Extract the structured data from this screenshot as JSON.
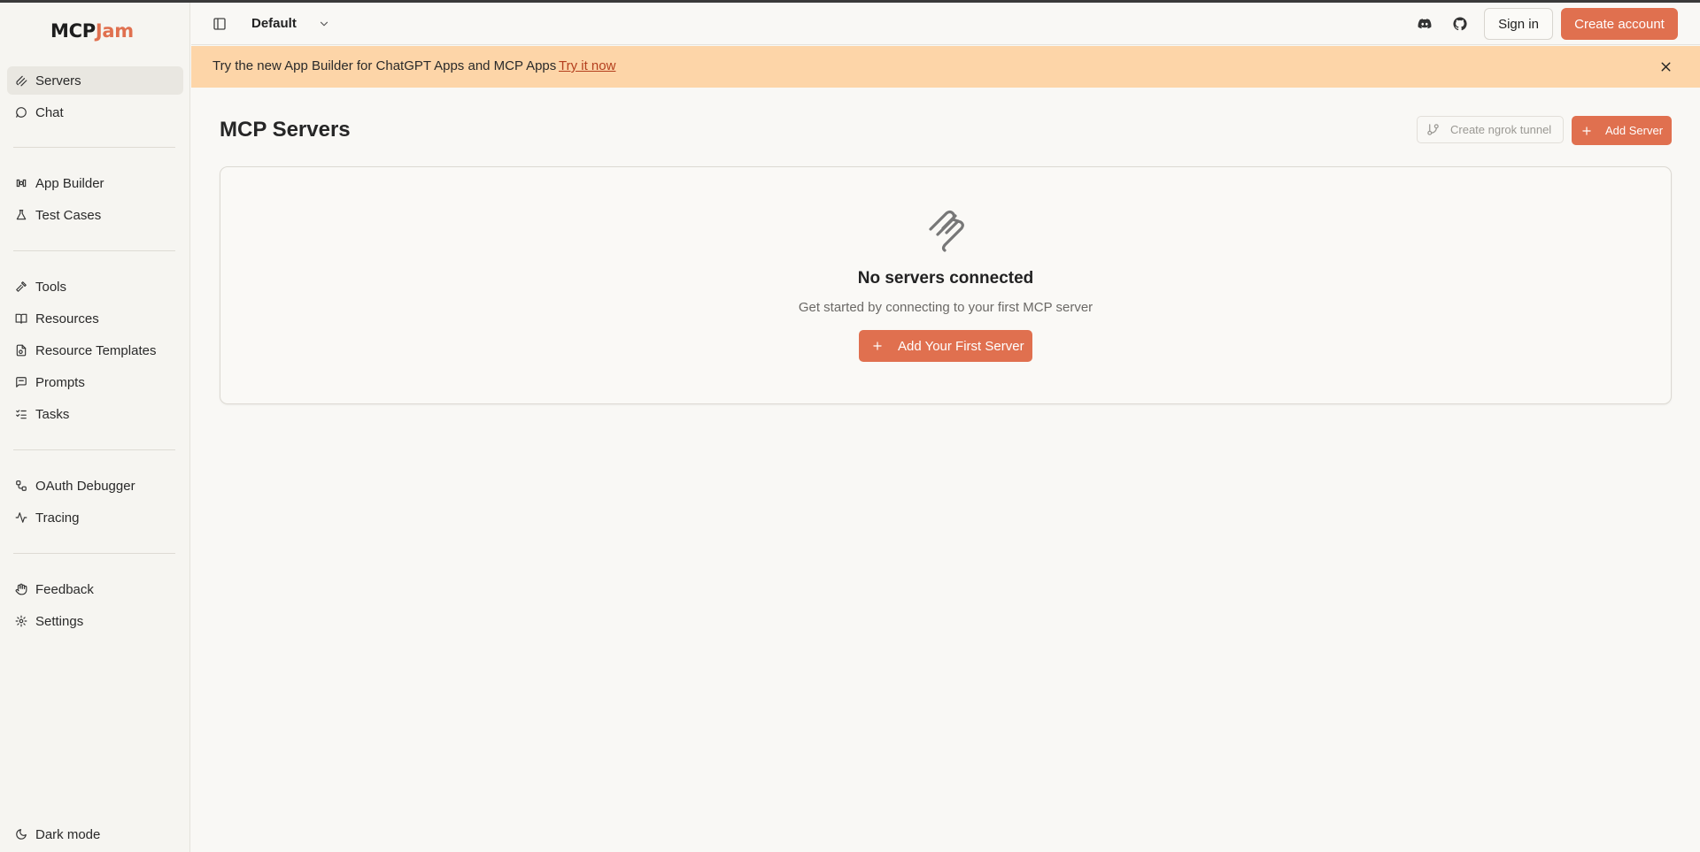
{
  "app": {
    "logo_part1": "MCP",
    "logo_part2": "Jam"
  },
  "sidebar": {
    "groups": [
      [
        {
          "label": "Servers",
          "icon": "servers-icon",
          "active": true
        },
        {
          "label": "Chat",
          "icon": "chat-icon"
        }
      ],
      [
        {
          "label": "App Builder",
          "icon": "app-builder-icon"
        },
        {
          "label": "Test Cases",
          "icon": "flask-icon"
        }
      ],
      [
        {
          "label": "Tools",
          "icon": "hammer-icon"
        },
        {
          "label": "Resources",
          "icon": "book-icon"
        },
        {
          "label": "Resource Templates",
          "icon": "file-template-icon"
        },
        {
          "label": "Prompts",
          "icon": "message-square-icon"
        },
        {
          "label": "Tasks",
          "icon": "list-checks-icon"
        }
      ],
      [
        {
          "label": "OAuth Debugger",
          "icon": "workflow-icon"
        },
        {
          "label": "Tracing",
          "icon": "activity-icon"
        }
      ],
      [
        {
          "label": "Feedback",
          "icon": "hand-icon"
        },
        {
          "label": "Settings",
          "icon": "gear-icon"
        }
      ]
    ],
    "dark_mode_label": "Dark mode"
  },
  "header": {
    "workspace": "Default",
    "sign_in": "Sign in",
    "create_account": "Create account"
  },
  "banner": {
    "text": "Try the new App Builder for ChatGPT Apps and MCP Apps",
    "link": "Try it now"
  },
  "main": {
    "title": "MCP Servers",
    "ngrok_button": "Create ngrok tunnel",
    "add_server_button": "Add Server",
    "empty": {
      "title": "No servers connected",
      "subtitle": "Get started by connecting to your first MCP server",
      "button": "Add Your First Server"
    }
  },
  "colors": {
    "accent": "#e0704f",
    "banner": "#fdd5a8",
    "background": "#f9f8f5"
  }
}
